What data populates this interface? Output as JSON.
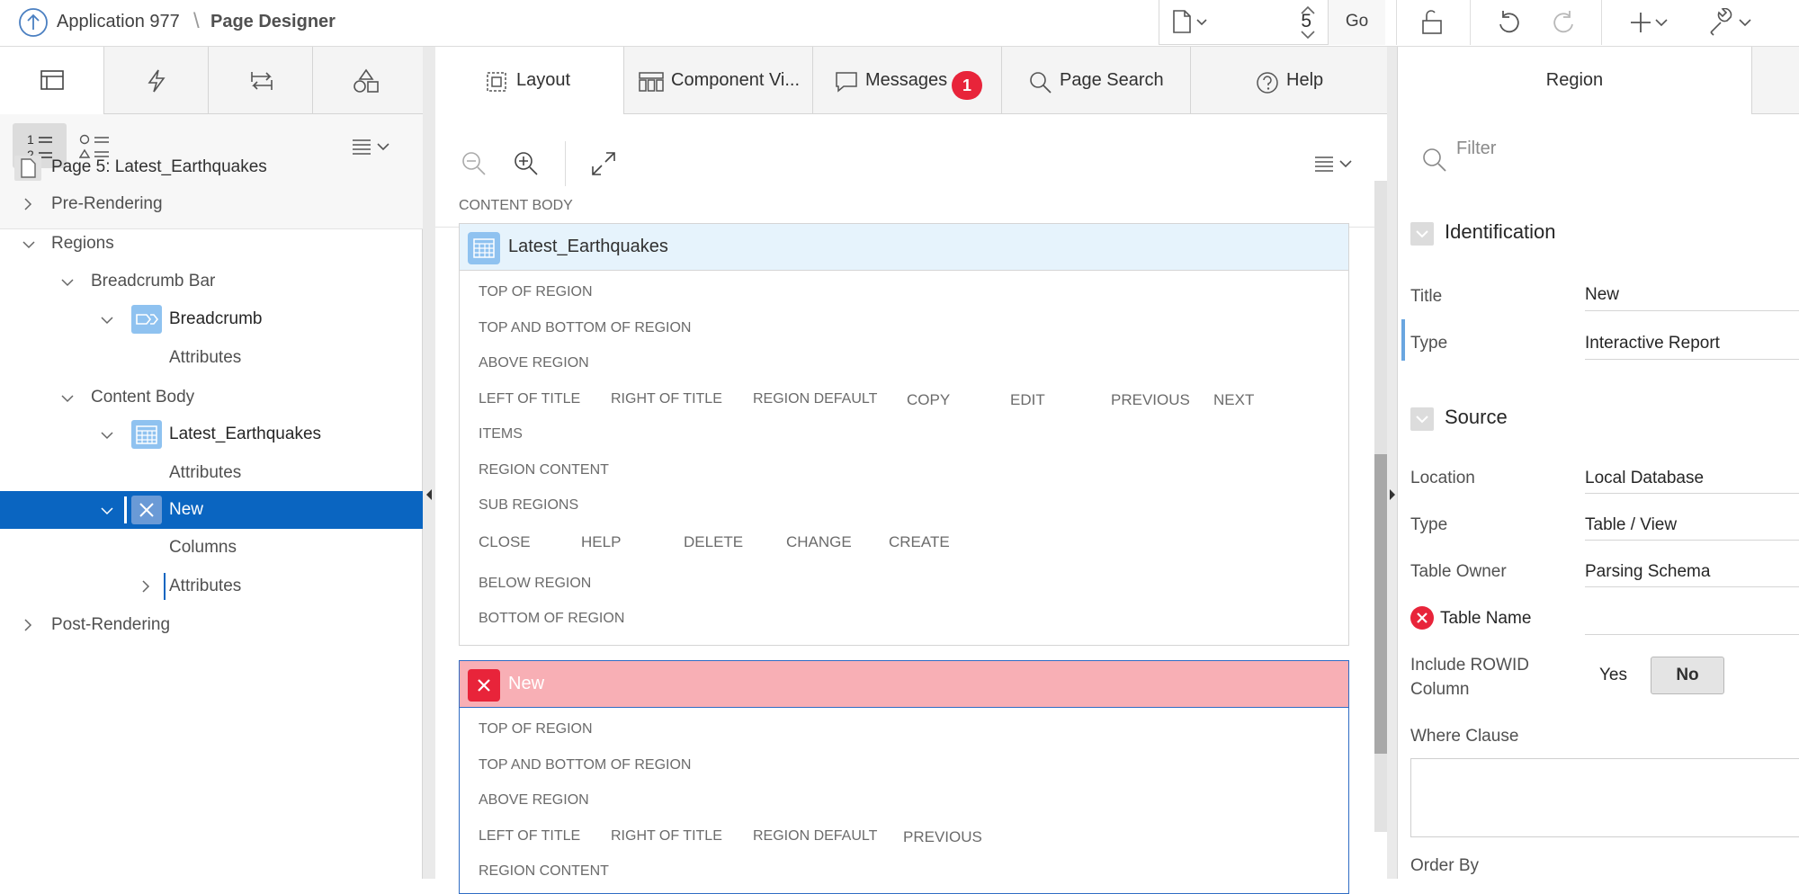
{
  "header": {
    "app_name": "Application 977",
    "separator": "\\",
    "page_designer": "Page Designer",
    "page_number": "5",
    "go_label": "Go"
  },
  "left_panel": {
    "tree": [
      {
        "label": "Page 5: Latest_Earthquakes"
      },
      {
        "label": "Pre-Rendering"
      },
      {
        "label": "Regions"
      },
      {
        "label": "Breadcrumb Bar"
      },
      {
        "label": "Breadcrumb"
      },
      {
        "label": "Attributes"
      },
      {
        "label": "Content Body"
      },
      {
        "label": "Latest_Earthquakes"
      },
      {
        "label": "Attributes"
      },
      {
        "label": "New"
      },
      {
        "label": "Columns"
      },
      {
        "label": "Attributes"
      },
      {
        "label": "Post-Rendering"
      }
    ]
  },
  "center": {
    "tabs": [
      {
        "label": "Layout"
      },
      {
        "label": "Component Vi..."
      },
      {
        "label": "Messages"
      },
      {
        "label": "Page Search"
      },
      {
        "label": "Help"
      }
    ],
    "messages_count": "1",
    "content_body_label": "CONTENT BODY",
    "region1": {
      "title": "Latest_Earthquakes",
      "positions": {
        "top": "TOP OF REGION",
        "top_bottom": "TOP AND BOTTOM OF REGION",
        "above": "ABOVE REGION",
        "left_title": "LEFT OF TITLE",
        "right_title": "RIGHT OF TITLE",
        "region_default": "REGION DEFAULT",
        "copy": "COPY",
        "edit": "EDIT",
        "previous": "PREVIOUS",
        "next": "NEXT",
        "items": "ITEMS",
        "content": "REGION CONTENT",
        "sub": "SUB REGIONS",
        "close": "CLOSE",
        "help": "HELP",
        "delete": "DELETE",
        "change": "CHANGE",
        "create": "CREATE",
        "below": "BELOW REGION",
        "bottom": "BOTTOM OF REGION"
      }
    },
    "region2": {
      "title": "New",
      "positions": {
        "top": "TOP OF REGION",
        "top_bottom": "TOP AND BOTTOM OF REGION",
        "above": "ABOVE REGION",
        "left_title": "LEFT OF TITLE",
        "right_title": "RIGHT OF TITLE",
        "region_default": "REGION DEFAULT",
        "previous": "PREVIOUS",
        "content": "REGION CONTENT"
      }
    }
  },
  "right_panel": {
    "tab_region": "Region",
    "filter_placeholder": "Filter",
    "identification": {
      "title": "Identification",
      "title_label": "Title",
      "title_value": "New",
      "type_label": "Type",
      "type_value": "Interactive Report"
    },
    "source": {
      "title": "Source",
      "location_label": "Location",
      "location_value": "Local Database",
      "type_label": "Type",
      "type_value": "Table / View",
      "owner_label": "Table Owner",
      "owner_value": "Parsing Schema",
      "table_name_label": "Table Name",
      "rowid_label_1": "Include ROWID",
      "rowid_label_2": "Column",
      "rowid_yes": "Yes",
      "rowid_no": "No",
      "where_label": "Where Clause",
      "order_label": "Order By"
    }
  },
  "colors": {
    "selected_row": "#0a65c1",
    "error_red": "#e8243a",
    "error_region_bg": "#f8afb5",
    "region_header_blue": "#e6f3fc",
    "region_icon_blue": "#8fc2f0"
  }
}
